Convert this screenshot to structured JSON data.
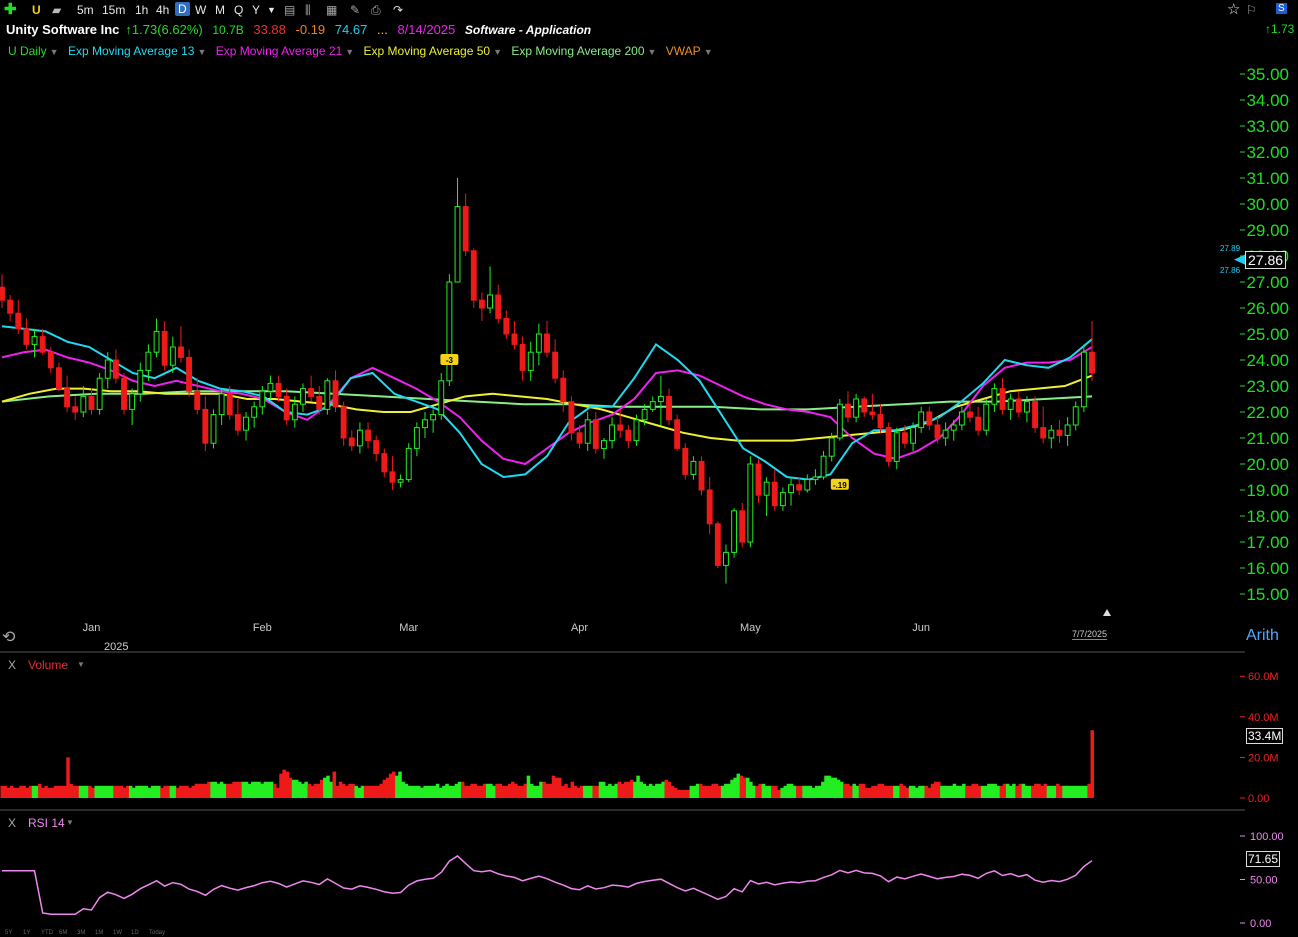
{
  "toolbar": {
    "ticker": "U",
    "timeframes": [
      "5m",
      "15m",
      "1h",
      "4h",
      "D",
      "W",
      "M",
      "Q",
      "Y"
    ],
    "selected": "D",
    "right_change": "1.73"
  },
  "header": {
    "name": "Unity Software Inc",
    "change": "1.73(6.62%)",
    "market_cap": "10.7B",
    "pe": "33.88",
    "eps_change": "-0.19",
    "rs": "74.67",
    "ellipsis": "...",
    "earnings_date": "8/14/2025",
    "sector": "Software - Application"
  },
  "legend": [
    {
      "label": "U Daily",
      "color": "#22dd22"
    },
    {
      "label": "Exp Moving Average 13",
      "color": "#22d8f0"
    },
    {
      "label": "Exp Moving Average 21",
      "color": "#ee22ee"
    },
    {
      "label": "Exp Moving Average 50",
      "color": "#f0f030"
    },
    {
      "label": "Exp Moving Average 200",
      "color": "#88ee88"
    },
    {
      "label": "VWAP",
      "color": "#f09020"
    }
  ],
  "price_axis": {
    "ticks": [
      "35.00",
      "34.00",
      "33.00",
      "32.00",
      "31.00",
      "30.00",
      "29.00",
      "28.00",
      "27.00",
      "26.00",
      "25.00",
      "24.00",
      "23.00",
      "22.00",
      "21.00",
      "20.00",
      "19.00",
      "18.00",
      "17.00",
      "16.00",
      "15.00"
    ],
    "last_price": "27.86",
    "small_high": "27.89",
    "small_low": "27.86",
    "scale": "Arith"
  },
  "time_axis": {
    "months": [
      "Jan",
      "Feb",
      "Mar",
      "Apr",
      "May",
      "Jun"
    ],
    "year": "2025",
    "last_date": "7/7/2025"
  },
  "events": {
    "badge1": "-3",
    "badge2": "-.19"
  },
  "volume": {
    "close": "X",
    "title": "Volume",
    "ticks": [
      "60.0M",
      "40.0M",
      "20.0M",
      "0.00"
    ],
    "last": "33.4M"
  },
  "rsi": {
    "close": "X",
    "title": "RSI 14",
    "ticks": [
      "100.00",
      "50.00",
      "0.00"
    ],
    "last": "71.65"
  },
  "bottom_timeframes": [
    "5Y",
    "1Y",
    "YTD",
    "6M",
    "3M",
    "1M",
    "1W",
    "1D",
    "Today"
  ],
  "chart_data": {
    "type": "candlestick",
    "x": [
      "2024-12-17",
      "2024-12-18",
      "2024-12-19",
      "2024-12-20",
      "2024-12-23",
      "2024-12-24",
      "2024-12-26",
      "2024-12-27",
      "2024-12-30",
      "2024-12-31",
      "2025-01-02",
      "2025-01-03",
      "2025-01-06",
      "2025-01-07",
      "2025-01-08",
      "2025-01-10",
      "2025-01-13",
      "2025-01-14",
      "2025-01-15",
      "2025-01-16",
      "2025-01-17",
      "2025-01-21",
      "2025-01-22",
      "2025-01-23",
      "2025-01-24",
      "2025-01-27",
      "2025-01-28",
      "2025-01-29",
      "2025-01-30",
      "2025-01-31",
      "2025-02-03",
      "2025-02-04",
      "2025-02-05",
      "2025-02-06",
      "2025-02-07",
      "2025-02-10",
      "2025-02-11",
      "2025-02-12",
      "2025-02-13",
      "2025-02-14",
      "2025-02-18",
      "2025-02-19",
      "2025-02-20",
      "2025-02-21",
      "2025-02-24",
      "2025-02-25",
      "2025-02-26",
      "2025-02-27",
      "2025-02-28",
      "2025-03-03",
      "2025-03-04",
      "2025-03-05",
      "2025-03-06",
      "2025-03-07",
      "2025-03-10",
      "2025-03-11",
      "2025-03-12",
      "2025-03-13",
      "2025-03-14",
      "2025-03-17",
      "2025-03-18",
      "2025-03-19",
      "2025-03-20",
      "2025-03-21",
      "2025-03-24",
      "2025-03-25",
      "2025-03-26",
      "2025-03-27",
      "2025-03-28",
      "2025-03-31",
      "2025-04-01",
      "2025-04-02",
      "2025-04-03",
      "2025-04-04",
      "2025-04-07",
      "2025-04-08",
      "2025-04-09",
      "2025-04-10",
      "2025-04-11",
      "2025-04-14",
      "2025-04-15",
      "2025-04-16",
      "2025-04-17",
      "2025-04-21",
      "2025-04-22",
      "2025-04-23",
      "2025-04-24",
      "2025-04-25",
      "2025-04-28",
      "2025-04-29",
      "2025-04-30",
      "2025-05-01",
      "2025-05-02",
      "2025-05-05",
      "2025-05-06",
      "2025-05-07",
      "2025-05-08",
      "2025-05-09",
      "2025-05-12",
      "2025-05-13",
      "2025-05-14",
      "2025-05-15",
      "2025-05-16",
      "2025-05-19",
      "2025-05-20",
      "2025-05-21",
      "2025-05-22",
      "2025-05-23",
      "2025-05-27",
      "2025-05-28",
      "2025-05-29",
      "2025-05-30",
      "2025-06-02",
      "2025-06-03",
      "2025-06-04",
      "2025-06-05",
      "2025-06-06",
      "2025-06-09",
      "2025-06-10",
      "2025-06-11",
      "2025-06-12",
      "2025-06-13",
      "2025-06-16",
      "2025-06-17",
      "2025-06-18",
      "2025-06-20",
      "2025-06-23",
      "2025-06-24",
      "2025-06-25",
      "2025-06-26",
      "2025-06-27",
      "2025-06-30",
      "2025-07-01",
      "2025-07-02",
      "2025-07-03",
      "2025-07-07"
    ],
    "ylim": [
      15,
      35
    ],
    "candles": [
      [
        26.8,
        27.3,
        26.0,
        26.3
      ],
      [
        26.3,
        26.5,
        25.5,
        25.8
      ],
      [
        25.8,
        26.3,
        25.0,
        25.2
      ],
      [
        25.2,
        25.6,
        24.4,
        24.6
      ],
      [
        24.6,
        25.2,
        24.1,
        24.9
      ],
      [
        24.9,
        25.2,
        24.2,
        24.3
      ],
      [
        24.3,
        24.5,
        23.5,
        23.7
      ],
      [
        23.7,
        23.9,
        22.8,
        22.9
      ],
      [
        22.9,
        23.4,
        22.0,
        22.2
      ],
      [
        22.2,
        22.6,
        21.7,
        22.0
      ],
      [
        22.0,
        23.0,
        21.8,
        22.6
      ],
      [
        22.6,
        22.9,
        21.9,
        22.1
      ],
      [
        22.1,
        23.5,
        21.9,
        23.3
      ],
      [
        23.3,
        24.3,
        22.9,
        24.0
      ],
      [
        24.0,
        24.4,
        23.1,
        23.3
      ],
      [
        23.3,
        23.5,
        21.9,
        22.1
      ],
      [
        22.1,
        22.9,
        21.5,
        22.7
      ],
      [
        22.7,
        23.9,
        22.4,
        23.6
      ],
      [
        23.6,
        24.6,
        23.2,
        24.3
      ],
      [
        24.3,
        25.6,
        24.1,
        25.1
      ],
      [
        25.1,
        25.5,
        23.6,
        23.8
      ],
      [
        23.8,
        24.9,
        23.5,
        24.5
      ],
      [
        24.5,
        25.3,
        23.9,
        24.1
      ],
      [
        24.1,
        24.4,
        22.6,
        22.8
      ],
      [
        22.8,
        23.3,
        21.9,
        22.1
      ],
      [
        22.1,
        22.6,
        20.5,
        20.8
      ],
      [
        20.8,
        22.1,
        20.6,
        21.9
      ],
      [
        21.9,
        22.9,
        21.5,
        22.7
      ],
      [
        22.7,
        23.0,
        21.7,
        21.9
      ],
      [
        21.9,
        22.5,
        21.1,
        21.3
      ],
      [
        21.3,
        22.0,
        20.9,
        21.8
      ],
      [
        21.8,
        22.4,
        21.4,
        22.2
      ],
      [
        22.2,
        23.0,
        21.9,
        22.8
      ],
      [
        22.8,
        23.4,
        22.5,
        23.1
      ],
      [
        23.1,
        23.4,
        22.4,
        22.6
      ],
      [
        22.6,
        22.9,
        21.5,
        21.7
      ],
      [
        21.7,
        22.6,
        21.4,
        22.3
      ],
      [
        22.3,
        23.1,
        22.0,
        22.9
      ],
      [
        22.9,
        23.4,
        22.4,
        22.6
      ],
      [
        22.6,
        23.0,
        21.9,
        22.1
      ],
      [
        22.1,
        23.3,
        21.9,
        23.2
      ],
      [
        23.2,
        23.6,
        22.0,
        22.2
      ],
      [
        22.2,
        22.4,
        20.7,
        21.0
      ],
      [
        21.0,
        21.3,
        20.5,
        20.7
      ],
      [
        20.7,
        21.6,
        20.4,
        21.3
      ],
      [
        21.3,
        21.6,
        20.6,
        20.9
      ],
      [
        20.9,
        21.1,
        20.1,
        20.4
      ],
      [
        20.4,
        20.6,
        19.5,
        19.7
      ],
      [
        19.7,
        20.3,
        19.0,
        19.3
      ],
      [
        19.3,
        19.6,
        19.1,
        19.4
      ],
      [
        19.4,
        20.8,
        19.3,
        20.6
      ],
      [
        20.6,
        21.6,
        20.3,
        21.4
      ],
      [
        21.4,
        22.0,
        21.0,
        21.7
      ],
      [
        21.7,
        22.1,
        21.2,
        21.9
      ],
      [
        21.9,
        23.5,
        21.7,
        23.2
      ],
      [
        23.2,
        27.3,
        23.0,
        27.0
      ],
      [
        27.0,
        31.0,
        27.0,
        29.9
      ],
      [
        29.9,
        30.4,
        28.0,
        28.2
      ],
      [
        28.2,
        28.3,
        26.0,
        26.3
      ],
      [
        26.3,
        26.6,
        25.5,
        26.0
      ],
      [
        26.0,
        27.6,
        25.8,
        26.5
      ],
      [
        26.5,
        26.9,
        25.4,
        25.6
      ],
      [
        25.6,
        25.9,
        24.8,
        25.0
      ],
      [
        25.0,
        25.5,
        24.4,
        24.6
      ],
      [
        24.6,
        24.9,
        23.2,
        23.6
      ],
      [
        23.6,
        24.7,
        23.2,
        24.3
      ],
      [
        24.3,
        25.4,
        23.8,
        25.0
      ],
      [
        25.0,
        25.5,
        24.1,
        24.3
      ],
      [
        24.3,
        24.8,
        23.1,
        23.3
      ],
      [
        23.3,
        23.6,
        22.0,
        22.4
      ],
      [
        22.4,
        22.6,
        20.9,
        21.2
      ],
      [
        21.2,
        21.5,
        20.6,
        20.8
      ],
      [
        20.8,
        22.0,
        20.5,
        21.7
      ],
      [
        21.7,
        22.0,
        20.4,
        20.6
      ],
      [
        20.6,
        21.0,
        20.2,
        20.9
      ],
      [
        20.9,
        21.8,
        20.6,
        21.5
      ],
      [
        21.5,
        22.1,
        21.0,
        21.3
      ],
      [
        21.3,
        21.5,
        20.6,
        20.9
      ],
      [
        20.9,
        21.9,
        20.7,
        21.7
      ],
      [
        21.7,
        22.3,
        21.5,
        22.1
      ],
      [
        22.1,
        22.6,
        22.0,
        22.4
      ],
      [
        22.4,
        23.4,
        21.5,
        22.6
      ],
      [
        22.6,
        22.9,
        21.5,
        21.7
      ],
      [
        21.7,
        21.9,
        20.5,
        20.6
      ],
      [
        20.6,
        20.8,
        19.4,
        19.6
      ],
      [
        19.6,
        20.3,
        19.4,
        20.1
      ],
      [
        20.1,
        20.3,
        18.8,
        19.0
      ],
      [
        19.0,
        19.5,
        17.3,
        17.7
      ],
      [
        17.7,
        17.8,
        16.0,
        16.1
      ],
      [
        16.1,
        16.9,
        15.4,
        16.6
      ],
      [
        16.6,
        18.3,
        16.4,
        18.2
      ],
      [
        18.2,
        18.5,
        16.8,
        17.0
      ],
      [
        17.0,
        20.3,
        16.8,
        20.0
      ],
      [
        20.0,
        20.2,
        18.5,
        18.8
      ],
      [
        18.8,
        19.5,
        18.0,
        19.3
      ],
      [
        19.3,
        19.8,
        18.2,
        18.4
      ],
      [
        18.4,
        19.1,
        18.2,
        18.9
      ],
      [
        18.9,
        19.5,
        18.4,
        19.2
      ],
      [
        19.2,
        19.5,
        18.8,
        19.0
      ],
      [
        19.0,
        19.6,
        18.9,
        19.4
      ],
      [
        19.4,
        19.8,
        19.2,
        19.5
      ],
      [
        19.5,
        20.5,
        19.4,
        20.3
      ],
      [
        20.3,
        21.2,
        20.1,
        21.0
      ],
      [
        21.0,
        22.5,
        20.9,
        22.3
      ],
      [
        22.3,
        22.8,
        21.6,
        21.8
      ],
      [
        21.8,
        22.7,
        21.6,
        22.5
      ],
      [
        22.5,
        22.6,
        21.8,
        22.0
      ],
      [
        22.0,
        22.7,
        21.7,
        21.9
      ],
      [
        21.9,
        22.3,
        21.2,
        21.4
      ],
      [
        21.4,
        21.6,
        19.9,
        20.1
      ],
      [
        20.1,
        21.4,
        19.8,
        21.2
      ],
      [
        21.2,
        21.5,
        20.6,
        20.8
      ],
      [
        20.8,
        21.6,
        20.5,
        21.4
      ],
      [
        21.4,
        22.2,
        21.2,
        22.0
      ],
      [
        22.0,
        22.2,
        21.3,
        21.5
      ],
      [
        21.5,
        21.8,
        20.8,
        21.0
      ],
      [
        21.0,
        21.6,
        20.7,
        21.3
      ],
      [
        21.3,
        21.7,
        20.9,
        21.5
      ],
      [
        21.5,
        22.2,
        21.3,
        22.0
      ],
      [
        22.0,
        22.4,
        21.6,
        21.8
      ],
      [
        21.8,
        22.2,
        21.1,
        21.3
      ],
      [
        21.3,
        22.5,
        21.1,
        22.3
      ],
      [
        22.3,
        23.1,
        22.0,
        22.9
      ],
      [
        22.9,
        23.3,
        21.9,
        22.1
      ],
      [
        22.1,
        22.7,
        21.7,
        22.5
      ],
      [
        22.5,
        22.8,
        21.8,
        22.0
      ],
      [
        22.0,
        22.6,
        21.6,
        22.4
      ],
      [
        22.4,
        22.6,
        21.2,
        21.4
      ],
      [
        21.4,
        22.2,
        20.8,
        21.0
      ],
      [
        21.0,
        21.5,
        20.6,
        21.3
      ],
      [
        21.3,
        21.7,
        20.8,
        21.1
      ],
      [
        21.1,
        21.8,
        20.7,
        21.5
      ],
      [
        21.5,
        22.4,
        21.3,
        22.2
      ],
      [
        22.2,
        24.6,
        22.0,
        24.3
      ],
      [
        24.3,
        25.5,
        23.2,
        23.5
      ]
    ],
    "ema13": [
      25.3,
      25.2,
      25.1,
      24.7,
      24.5,
      24.0,
      23.5,
      23.3,
      23.7,
      23.2,
      22.9,
      22.8,
      22.6,
      22.0,
      21.9,
      22.2,
      23.3,
      23.5,
      22.7,
      22.4,
      22.1,
      21.2,
      20.0,
      19.5,
      19.6,
      20.3,
      21.6,
      22.2,
      22.2,
      23.3,
      24.6,
      24.0,
      23.2,
      21.9,
      20.6,
      20.1,
      19.5,
      19.4,
      19.6,
      20.8,
      21.3,
      21.3,
      21.5,
      21.8,
      22.4,
      23.1,
      24.0,
      23.8,
      23.7,
      24.1,
      24.8
    ],
    "ema21": [
      24.1,
      24.3,
      24.4,
      24.1,
      23.9,
      23.6,
      23.2,
      23.0,
      23.2,
      23.0,
      22.8,
      22.7,
      22.5,
      22.0,
      21.7,
      22.3,
      23.3,
      23.7,
      23.3,
      22.9,
      22.4,
      21.8,
      20.9,
      20.2,
      20.0,
      20.6,
      21.2,
      21.6,
      21.9,
      22.5,
      23.5,
      23.6,
      23.4,
      23.0,
      22.6,
      22.3,
      22.1,
      22.0,
      21.8,
      21.0,
      20.4,
      20.2,
      20.5,
      21.0,
      21.9,
      23.0,
      23.7,
      23.9,
      23.9,
      24.0,
      24.5
    ],
    "ema50": [
      22.4,
      22.7,
      22.9,
      22.9,
      22.8,
      22.8,
      22.7,
      22.7,
      22.7,
      22.5,
      22.5,
      22.4,
      22.3,
      22.1,
      22.0,
      22.0,
      22.3,
      22.6,
      22.7,
      22.6,
      22.5,
      22.3,
      22.1,
      21.8,
      21.5,
      21.2,
      21.0,
      20.9,
      20.9,
      20.9,
      21.0,
      21.1,
      21.2,
      21.3,
      21.6,
      22.2,
      22.5,
      22.8,
      22.9,
      23.0,
      23.4
    ],
    "ema200": [
      22.4,
      22.6,
      22.7,
      22.7,
      22.8,
      22.8,
      22.8,
      22.7,
      22.6,
      22.5,
      22.4,
      22.3,
      22.3,
      22.2,
      22.2,
      22.2,
      22.1,
      22.1,
      22.2,
      22.3,
      22.4,
      22.4,
      22.5,
      22.6
    ],
    "volume_m": [
      6,
      6,
      5,
      6,
      5,
      5,
      6,
      6,
      5,
      6,
      6,
      6,
      7,
      5,
      6,
      5,
      5,
      6,
      6,
      6,
      6,
      20,
      7,
      6,
      6,
      6,
      6,
      6,
      6,
      5,
      6,
      6,
      6,
      6,
      6,
      6,
      6,
      6,
      6,
      5,
      6,
      6,
      5,
      6,
      6,
      6,
      6,
      5,
      6,
      6,
      6,
      5,
      6,
      6,
      6,
      6,
      5,
      6,
      6,
      6,
      5,
      6,
      7,
      7,
      7,
      7,
      8,
      8,
      8,
      7,
      8,
      7,
      7,
      7,
      8,
      8,
      8,
      8,
      8,
      7,
      8,
      8,
      8,
      7,
      8,
      8,
      8,
      7,
      5,
      12,
      14,
      13,
      10,
      9,
      9,
      8,
      7,
      8,
      7,
      6,
      7,
      7,
      9,
      10,
      11,
      8,
      13,
      6,
      8,
      7,
      6,
      7,
      7,
      6,
      5,
      6,
      6,
      6,
      6,
      6,
      6,
      7,
      9,
      10,
      12,
      13,
      11,
      13,
      8,
      7,
      6,
      6,
      6,
      6,
      5,
      6,
      6,
      6,
      6,
      7,
      5,
      6,
      7,
      6,
      6,
      7,
      8,
      8,
      6,
      6,
      7,
      7,
      6,
      6,
      7,
      7,
      7,
      6,
      7,
      7,
      6,
      6,
      7,
      8,
      7,
      6,
      6,
      7,
      11,
      7,
      6,
      6,
      8,
      8,
      7,
      7,
      11,
      10,
      10,
      6,
      7,
      5,
      8,
      6,
      5,
      6,
      6,
      6,
      6,
      6,
      6,
      8,
      8,
      6,
      7,
      6,
      7,
      8,
      7,
      8,
      8,
      9,
      8,
      11,
      8,
      7,
      6,
      7,
      6,
      7,
      7,
      8,
      9,
      8,
      6,
      5,
      4,
      4,
      4,
      4,
      6,
      6,
      7,
      7,
      6,
      6,
      6,
      7,
      7,
      6,
      6,
      7,
      7,
      9,
      10,
      12,
      11,
      10,
      10,
      8,
      6,
      6,
      7,
      7,
      6,
      6,
      6,
      6,
      4,
      5,
      6,
      7,
      7,
      6,
      6,
      6,
      6,
      6,
      6,
      5,
      6,
      6,
      8,
      11,
      11,
      10,
      10,
      9,
      8,
      7,
      7,
      6,
      7,
      6,
      7,
      7,
      5,
      5,
      6,
      6,
      7,
      7,
      6,
      6,
      6,
      6,
      6,
      7,
      6,
      5,
      6,
      6,
      5,
      6,
      6,
      6,
      5,
      7,
      8,
      8,
      6,
      6,
      6,
      6,
      7,
      6,
      6,
      7,
      6,
      6,
      7,
      7,
      6,
      6,
      6,
      7,
      7,
      7,
      6,
      6,
      7,
      7,
      6,
      7,
      6,
      7,
      7,
      6,
      6,
      6,
      7,
      7,
      6,
      7,
      6,
      6,
      6,
      7,
      6,
      6,
      6,
      6,
      6,
      6,
      6,
      6,
      6,
      7,
      33.4
    ]
  }
}
